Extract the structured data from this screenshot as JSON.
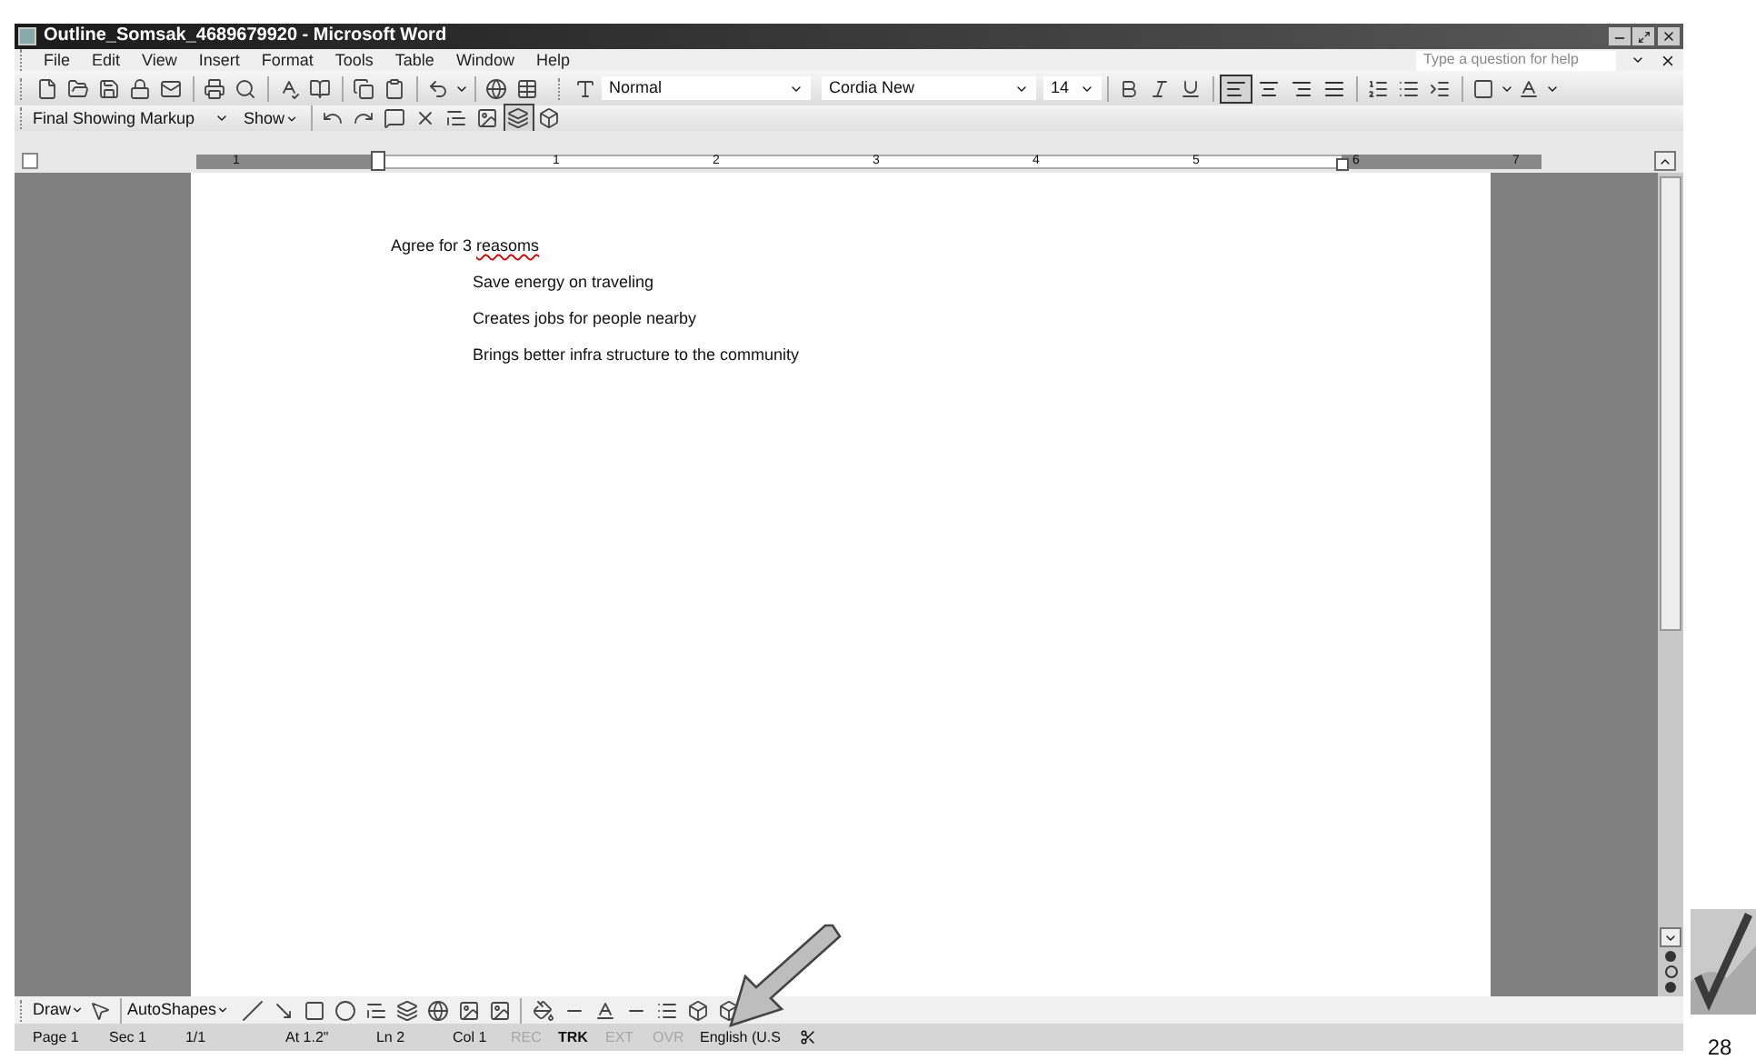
{
  "window": {
    "title": "Outline_Somsak_4689679920 - Microsoft Word"
  },
  "menu": [
    "File",
    "Edit",
    "View",
    "Insert",
    "Format",
    "Tools",
    "Table",
    "Window",
    "Help"
  ],
  "help_box": {
    "placeholder": "Type a question for help"
  },
  "format_toolbar": {
    "style": "Normal",
    "font": "Cordia New",
    "size": "14",
    "alignments": [
      {
        "kind": "left",
        "selected": true
      },
      {
        "kind": "center",
        "selected": false
      },
      {
        "kind": "right",
        "selected": false
      },
      {
        "kind": "justify",
        "selected": false
      }
    ]
  },
  "reviewing_toolbar": {
    "display": "Final Showing Markup",
    "show": "Show"
  },
  "ruler": {
    "labels": [
      "1",
      "1",
      "2",
      "3",
      "4",
      "5",
      "6",
      "7"
    ]
  },
  "document": {
    "lines": [
      {
        "segments": [
          {
            "text": "Agree for 3 ",
            "misspelled": false
          },
          {
            "text": "reasoms",
            "misspelled": true
          }
        ],
        "children": [
          {
            "segments": [
              {
                "text": "Save energy on traveling",
                "misspelled": false
              }
            ]
          },
          {
            "segments": [
              {
                "text": "Creates jobs for people nearby",
                "misspelled": false
              }
            ]
          },
          {
            "segments": [
              {
                "text": "Brings better infra structure to the community",
                "misspelled": false
              }
            ]
          }
        ]
      }
    ]
  },
  "drawing_toolbar": {
    "draw": "Draw",
    "autoshapes": "AutoShapes"
  },
  "status_bar": {
    "fields": [
      "Page 1",
      "Sec 1",
      "1/1",
      "At 1.2\"",
      "Ln 2",
      "Col 1"
    ],
    "modes": [
      {
        "label": "REC",
        "enabled": false
      },
      {
        "label": "TRK",
        "enabled": true
      },
      {
        "label": "EXT",
        "enabled": false
      },
      {
        "label": "OVR",
        "enabled": false
      }
    ],
    "language": "English (U.S"
  },
  "page_number": "28"
}
